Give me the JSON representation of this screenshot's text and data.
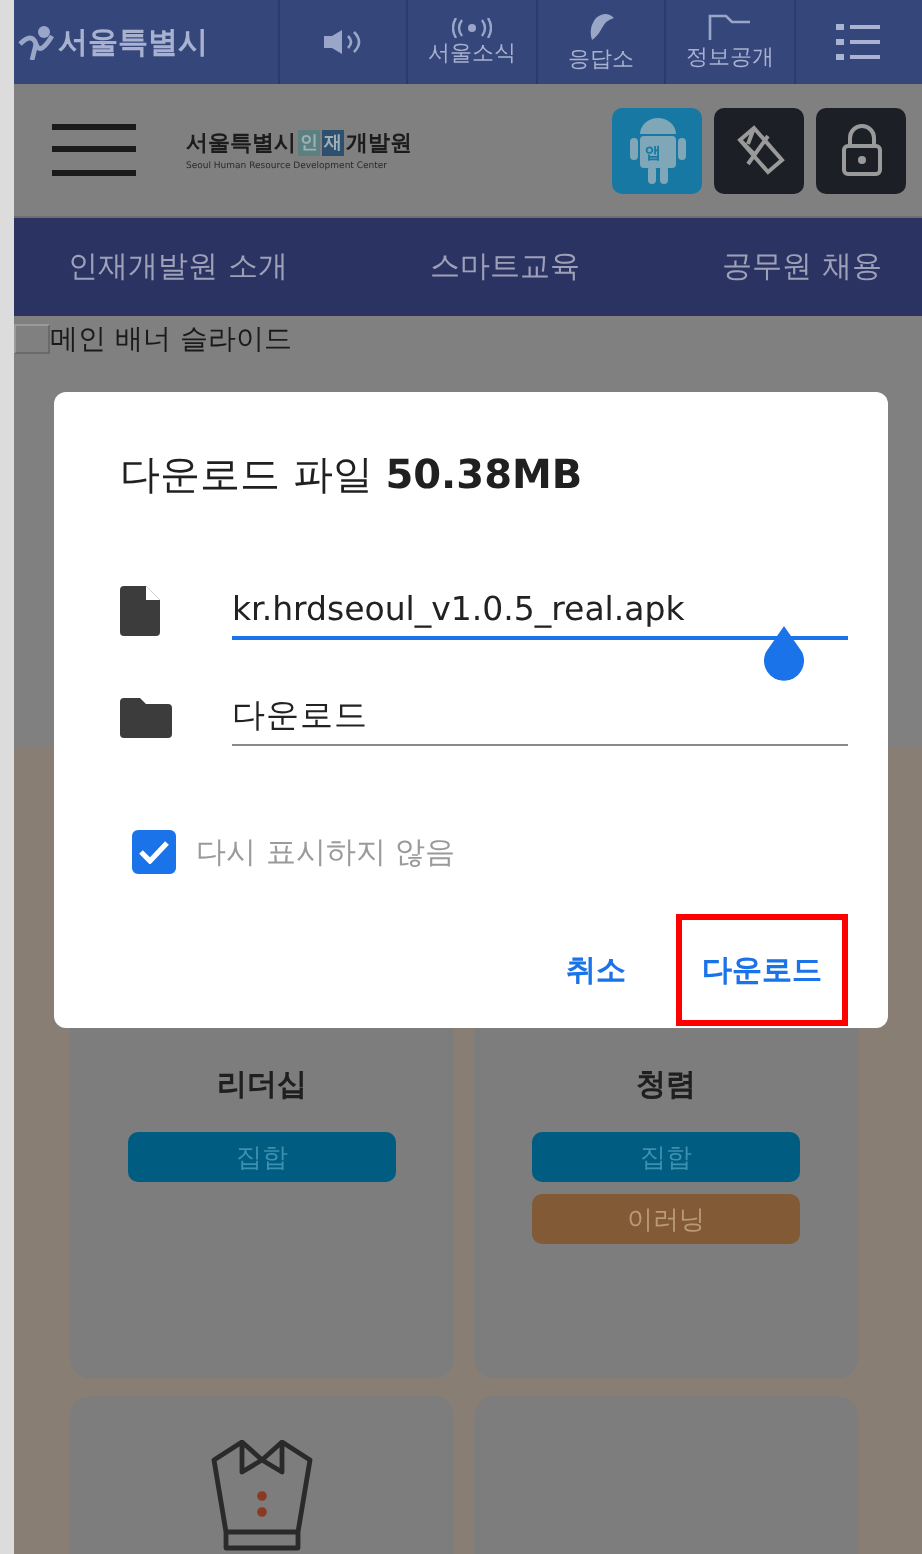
{
  "top_bar": {
    "logo": "서울특별시",
    "links": [
      {
        "kind": "speaker"
      },
      {
        "kind": "news",
        "label": "서울소식"
      },
      {
        "kind": "response",
        "label": "응답소"
      },
      {
        "kind": "info",
        "label": "정보공개"
      },
      {
        "kind": "menu"
      }
    ]
  },
  "header": {
    "logo_prefix": "서울특별시",
    "logo_highlight": [
      "인",
      "재"
    ],
    "logo_suffix": "개발원",
    "logo_subtitle": "Seoul Human Resource Development Center",
    "app_buttons": [
      {
        "kind": "android",
        "label": "앱"
      },
      {
        "kind": "ribbon"
      },
      {
        "kind": "lock"
      }
    ]
  },
  "nav": [
    {
      "label": "인재개발원 소개"
    },
    {
      "label": "스마트교육"
    },
    {
      "label": "공무원 채용"
    }
  ],
  "banner": {
    "label": "메인 배너 슬라이드"
  },
  "cards": [
    {
      "kind": "course",
      "title": "리더십",
      "tags": [
        {
          "label": "집합",
          "kind": "offline"
        }
      ]
    },
    {
      "kind": "course",
      "title": "청렴",
      "tags": [
        {
          "label": "집합",
          "kind": "offline"
        },
        {
          "label": "이러닝",
          "kind": "online"
        }
      ]
    },
    {
      "kind": "shirt"
    },
    {
      "kind": "blank"
    }
  ],
  "dialog": {
    "title": "다운로드 파일 **50.38MB**",
    "fields": [
      {
        "kind": "file",
        "value": "kr.hrdseoul_v1.0.5_real.apk",
        "focused": true
      },
      {
        "kind": "folder",
        "value": "다운로드",
        "focused": false
      }
    ],
    "checkbox": {
      "label": "다시 표시하지 않음",
      "checked": true
    },
    "buttons": [
      {
        "label": "취소",
        "highlighted": false
      },
      {
        "label": "다운로드",
        "highlighted": true
      }
    ]
  }
}
